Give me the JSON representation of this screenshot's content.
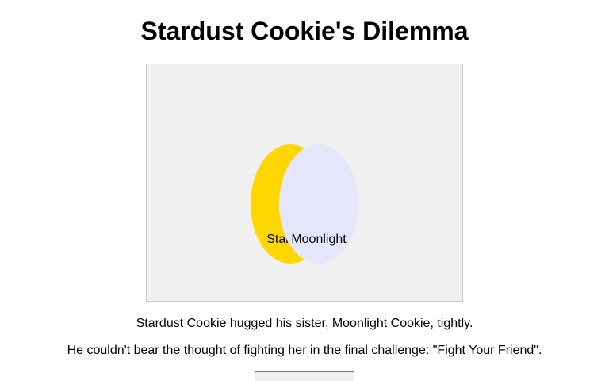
{
  "title": "Stardust Cookie's Dilemma",
  "scene": {
    "characters": [
      {
        "name": "Stardust",
        "color": "#ffd700"
      },
      {
        "name": "Moonlight",
        "color": "#e6e6fa"
      }
    ]
  },
  "story": {
    "line1": "Stardust Cookie hugged his sister, Moonlight Cookie, tightly.",
    "line2": "He couldn't bear the thought of fighting her in the final challenge: \"Fight Your Friend\"."
  },
  "colors": {
    "scene_background": "#f0f0f0",
    "scene_border": "#cccccc"
  }
}
